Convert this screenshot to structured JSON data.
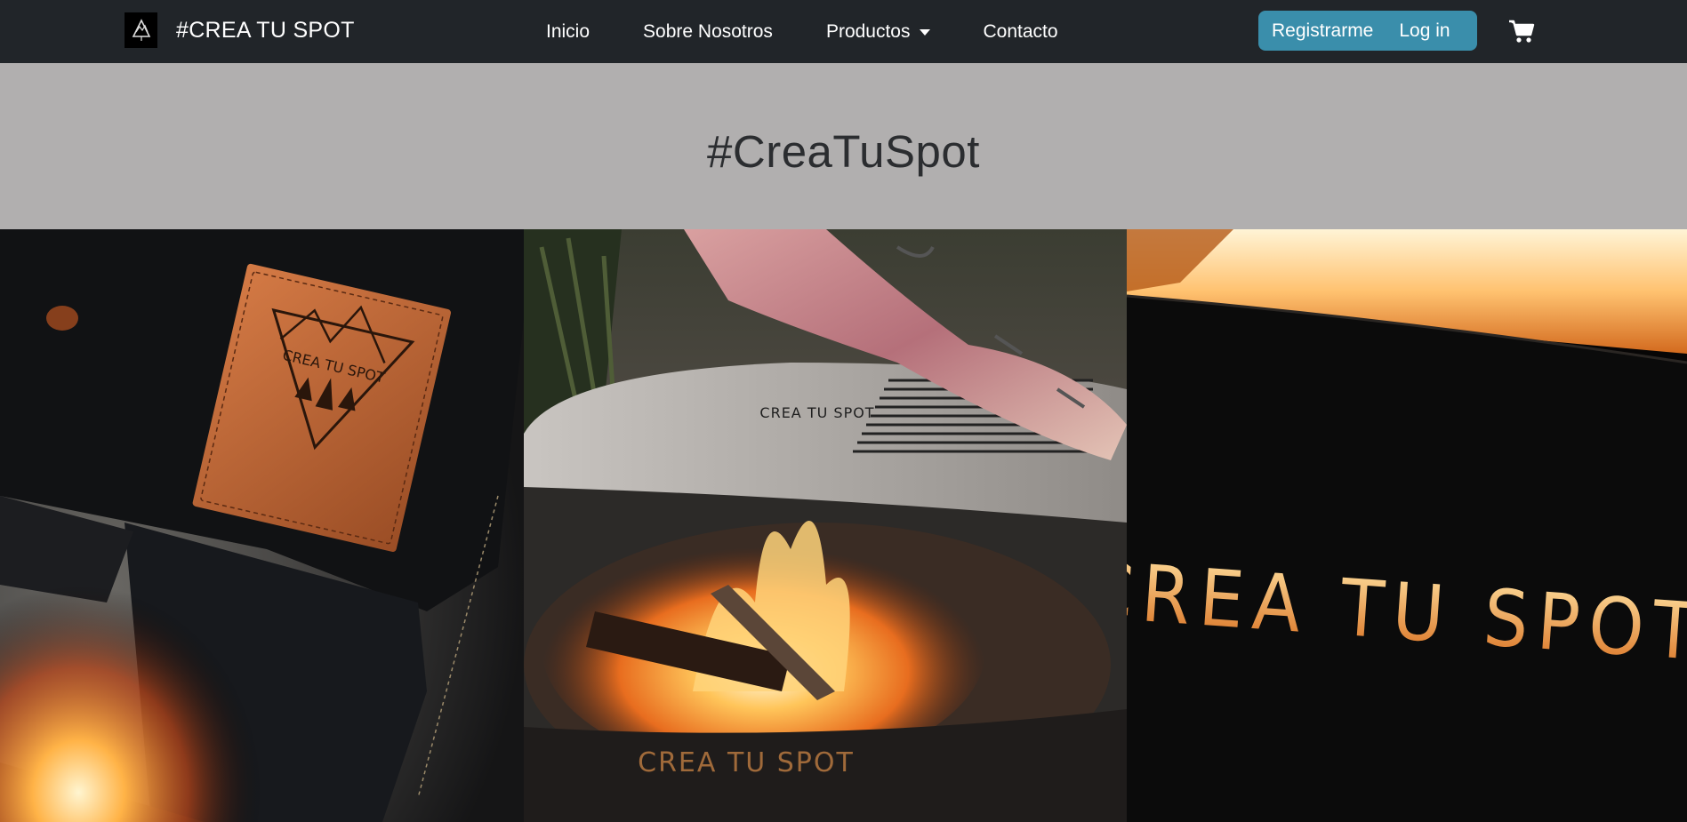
{
  "navbar": {
    "brand_text": "#CREA TU SPOT",
    "links": [
      {
        "label": "Inicio"
      },
      {
        "label": "Sobre Nosotros"
      },
      {
        "label": "Productos",
        "dropdown": true
      },
      {
        "label": "Contacto"
      }
    ],
    "auth": {
      "register_label": "Registrarme",
      "login_label": "Log in",
      "color": "#3a8eab"
    },
    "cart_icon": "shopping-cart-icon",
    "background": "#212529"
  },
  "hero": {
    "title": "#CreaTuSpot",
    "background": "#b1afaf"
  },
  "gallery": {
    "panels": [
      {
        "patch_text": "CREA TU SPOT"
      },
      {
        "engraving_top": "CREA TU SPOT",
        "engraving_bottom": "CREA TU SPOT"
      },
      {
        "cutout_text": "CREA TU SPOT"
      }
    ]
  }
}
